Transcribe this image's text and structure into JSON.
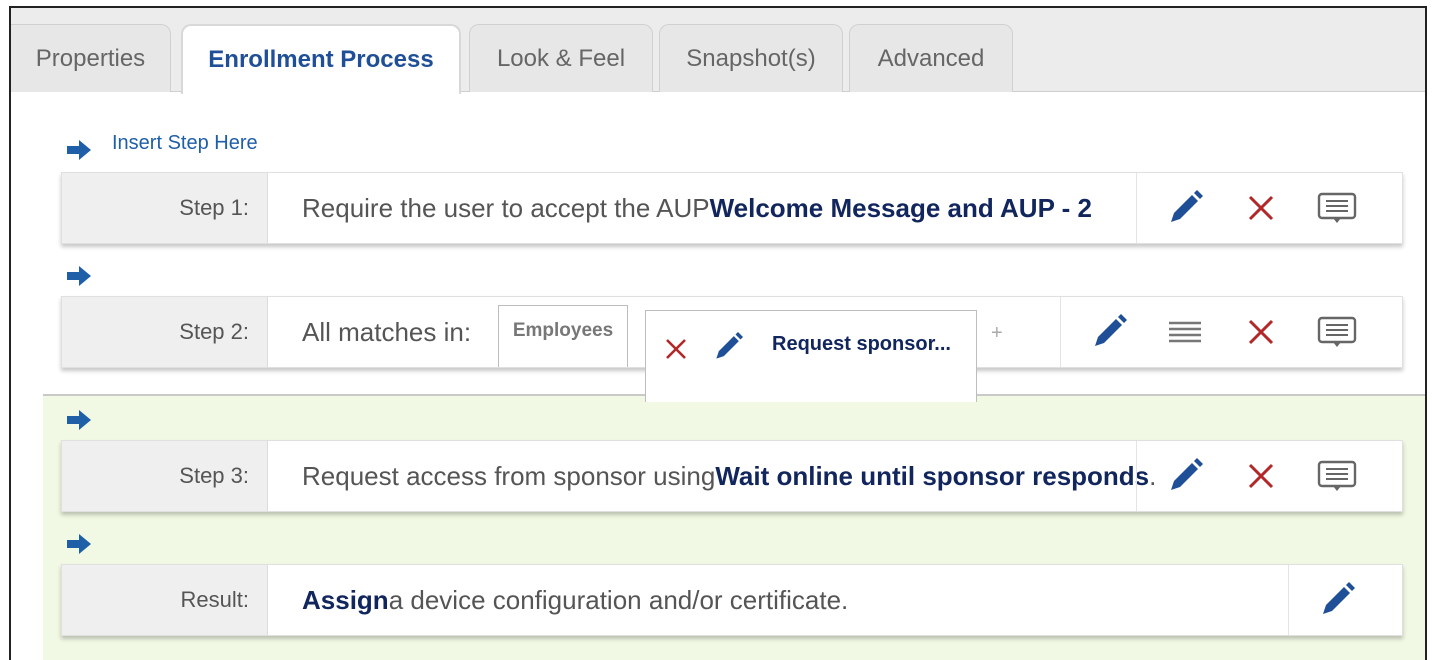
{
  "tabs": [
    {
      "label": "Properties"
    },
    {
      "label": "Enrollment Process"
    },
    {
      "label": "Look & Feel"
    },
    {
      "label": "Snapshot(s)"
    },
    {
      "label": "Advanced"
    }
  ],
  "insert_step": {
    "label": "Insert Step Here"
  },
  "steps": [
    {
      "label": "Step 1:",
      "text": "Require the user to accept the AUP ",
      "bold": "Welcome Message and AUP - 2",
      "suffix": ""
    },
    {
      "label": "Step 2:",
      "text": "All matches in:",
      "chip": "Employees",
      "popup_title": "Request sponsor...",
      "plus": "+"
    },
    {
      "label": "Step 3:",
      "text": "Request access from sponsor using ",
      "bold": "Wait online until sponsor responds",
      "suffix": "."
    },
    {
      "label": "Result:",
      "bold": "Assign",
      "text": " a device configuration and/or certificate."
    }
  ],
  "colors": {
    "accent": "#1f4f97",
    "delete": "#b22727",
    "arrow": "#1f5fa8",
    "green_zone": "#f1f8e3"
  },
  "icons": {
    "edit": "pencil-icon",
    "delete": "close-icon",
    "reorder": "menu-lines-icon",
    "comment": "message-icon",
    "arrow": "arrow-right-icon"
  }
}
